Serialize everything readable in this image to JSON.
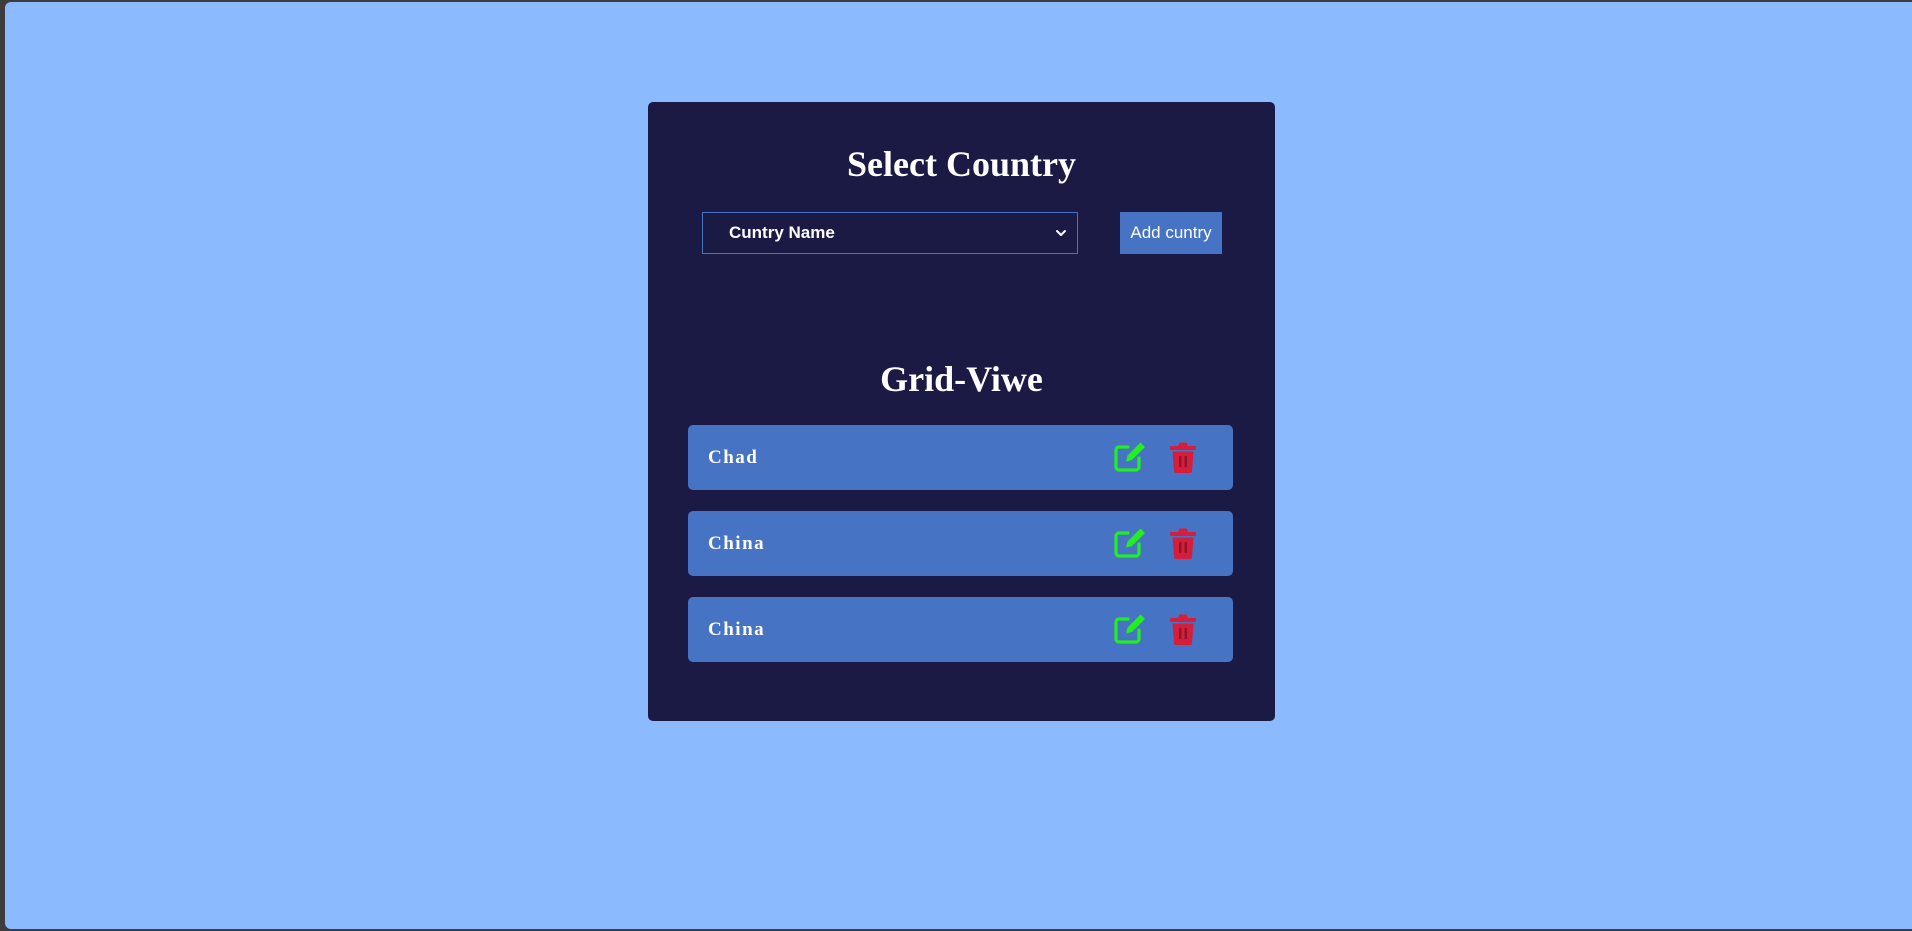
{
  "header": {
    "select_title": "Select Country",
    "grid_title": "Grid-Viwe"
  },
  "form": {
    "select_value": "Cuntry Name",
    "add_label": "Add cuntry"
  },
  "grid": {
    "rows": [
      {
        "name": "Chad"
      },
      {
        "name": "China"
      },
      {
        "name": "China"
      }
    ]
  },
  "colors": {
    "page_background": "#8bbbfe",
    "card_background": "#1b1a44",
    "accent": "#4673c4",
    "edit_icon": "#22ee22",
    "delete_icon": "#d61e3c"
  },
  "icons": {
    "select_chevron": "chevron-down-icon",
    "edit": "edit-icon",
    "delete": "trash-icon"
  }
}
